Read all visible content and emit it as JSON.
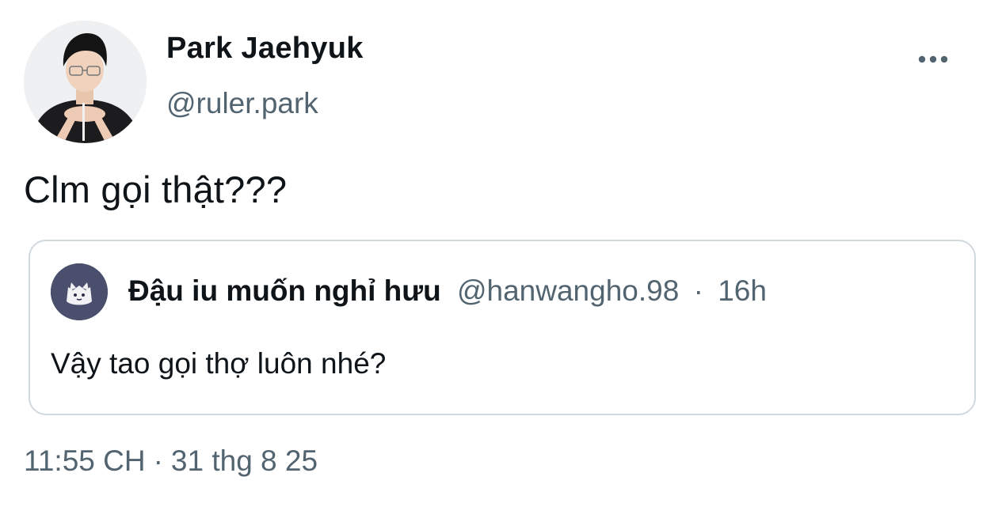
{
  "author": {
    "display_name": "Park Jaehyuk",
    "handle": "@ruler.park",
    "avatar_icon": "profile-photo"
  },
  "actions": {
    "more_icon": "more-horizontal-icon"
  },
  "tweet": {
    "text": "Clm gọi thật???",
    "time": "11:55 CH",
    "separator": "·",
    "date": "31 thg 8 25"
  },
  "quoted_tweet": {
    "display_name": "Đậu iu muốn nghỉ hưu",
    "handle": "@hanwangho.98",
    "separator": "·",
    "age": "16h",
    "text": "Vậy tao gọi thợ luôn nhé?",
    "avatar_icon": "cat-avatar-icon"
  },
  "colors": {
    "text_primary": "#0f1419",
    "text_secondary": "#536471",
    "card_border": "#cfd9de",
    "quote_avatar_bg": "#4a4f6e"
  }
}
